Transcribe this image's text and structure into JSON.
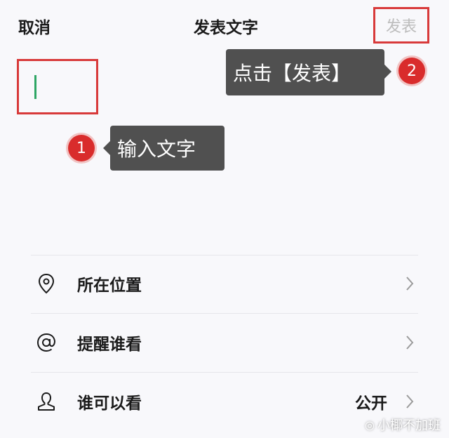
{
  "header": {
    "cancel_label": "取消",
    "title": "发表文字",
    "publish_label": "发表"
  },
  "annotations": {
    "step1_number": "1",
    "step1_text": "输入文字",
    "step2_number": "2",
    "step2_text": "点击【发表】"
  },
  "options": {
    "location_label": "所在位置",
    "remind_label": "提醒谁看",
    "visible_label": "谁可以看",
    "visible_value": "公开"
  },
  "watermark": {
    "text": "小椰不加班"
  },
  "colors": {
    "highlight": "#d83a3a",
    "caret": "#2ea664",
    "callout_bg": "#505050",
    "badge": "#d92c2c",
    "publish_disabled": "#bdbdbd"
  }
}
